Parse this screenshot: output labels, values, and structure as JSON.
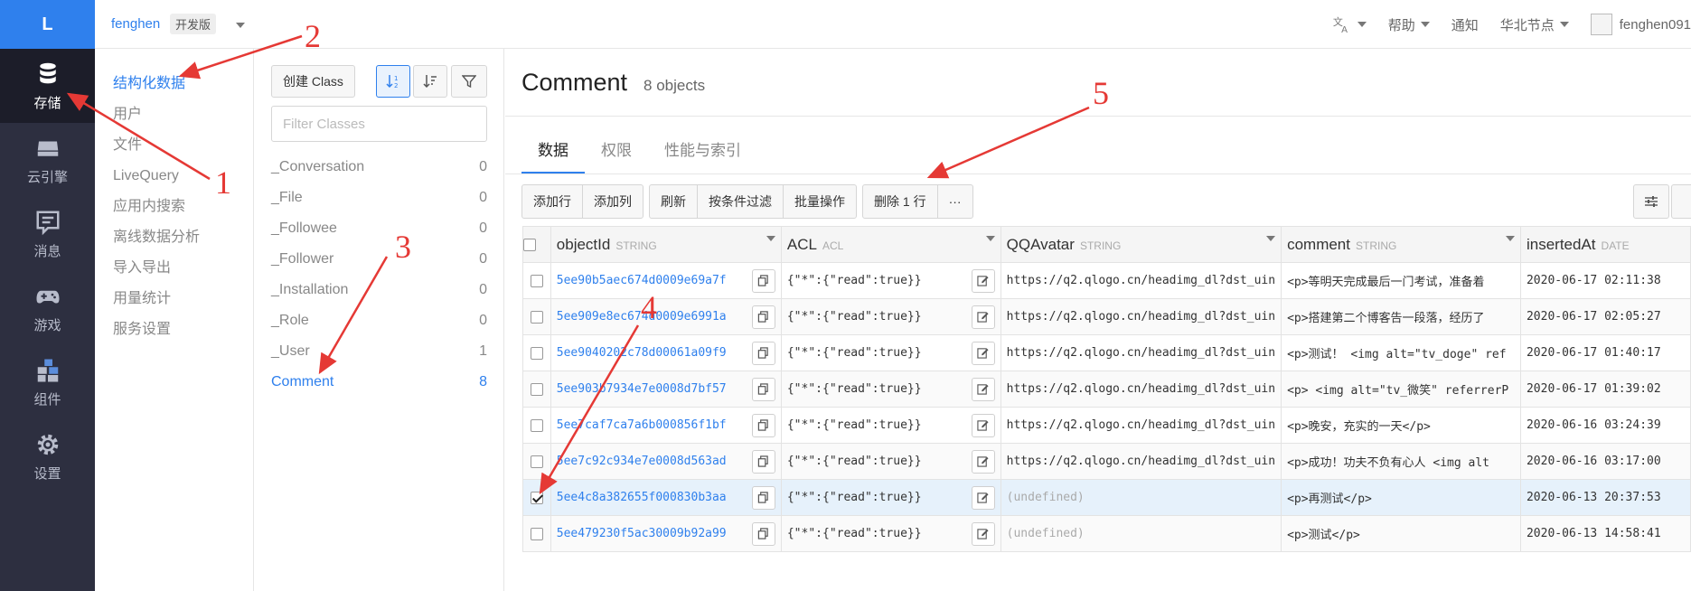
{
  "rail": {
    "logo": "L",
    "items": [
      {
        "label": "存储",
        "icon": "database-icon",
        "active": true
      },
      {
        "label": "云引擎",
        "icon": "server-icon",
        "active": false
      },
      {
        "label": "消息",
        "icon": "message-icon",
        "active": false
      },
      {
        "label": "游戏",
        "icon": "gamepad-icon",
        "active": false
      },
      {
        "label": "组件",
        "icon": "components-icon",
        "active": false
      },
      {
        "label": "设置",
        "icon": "gear-icon",
        "active": false
      }
    ]
  },
  "topbar": {
    "app_name": "fenghen",
    "plan_badge": "开发版",
    "translate_icon": "translate-icon",
    "help": "帮助",
    "notify": "通知",
    "region": "华北节点",
    "username": "fenghen091"
  },
  "subnav": {
    "items": [
      "结构化数据",
      "用户",
      "文件",
      "LiveQuery",
      "应用内搜索",
      "离线数据分析",
      "导入导出",
      "用量统计",
      "服务设置"
    ],
    "active_index": 0
  },
  "classes": {
    "create_label": "创建 Class",
    "filter_placeholder": "Filter Classes",
    "list": [
      {
        "name": "_Conversation",
        "count": "0"
      },
      {
        "name": "_File",
        "count": "0"
      },
      {
        "name": "_Followee",
        "count": "0"
      },
      {
        "name": "_Follower",
        "count": "0"
      },
      {
        "name": "_Installation",
        "count": "0"
      },
      {
        "name": "_Role",
        "count": "0"
      },
      {
        "name": "_User",
        "count": "1"
      },
      {
        "name": "Comment",
        "count": "8",
        "active": true
      }
    ]
  },
  "main": {
    "title": "Comment",
    "count": "8 objects",
    "tabs": [
      "数据",
      "权限",
      "性能与索引"
    ],
    "toolbar": {
      "add_row": "添加行",
      "add_col": "添加列",
      "refresh": "刷新",
      "filter": "按条件过滤",
      "batch": "批量操作",
      "delete": "删除 1 行",
      "more": "···"
    },
    "columns": [
      {
        "name": "objectId",
        "type": "STRING"
      },
      {
        "name": "ACL",
        "type": "ACL"
      },
      {
        "name": "QQAvatar",
        "type": "STRING"
      },
      {
        "name": "comment",
        "type": "STRING"
      },
      {
        "name": "insertedAt",
        "type": "DATE"
      }
    ],
    "rows": [
      {
        "id": "5ee90b5aec674d0009e69a7f",
        "acl": "{\"*\":{\"read\":true}}",
        "avatar": "https://q2.qlogo.cn/headimg_dl?dst_uin",
        "comment": "<p>等明天完成最后一门考试，准备着",
        "date": "2020-06-17 02:11:38",
        "checked": false
      },
      {
        "id": "5ee909e8ec674d0009e6991a",
        "acl": "{\"*\":{\"read\":true}}",
        "avatar": "https://q2.qlogo.cn/headimg_dl?dst_uin",
        "comment": "<p>搭建第二个博客告一段落，经历了",
        "date": "2020-06-17 02:05:27",
        "checked": false
      },
      {
        "id": "5ee9040202c78d00061a09f9",
        "acl": "{\"*\":{\"read\":true}}",
        "avatar": "https://q2.qlogo.cn/headimg_dl?dst_uin",
        "comment": "<p>测试！ <img alt=\"tv_doge\" ref",
        "date": "2020-06-17 01:40:17",
        "checked": false
      },
      {
        "id": "5ee903b7934e7e0008d7bf57",
        "acl": "{\"*\":{\"read\":true}}",
        "avatar": "https://q2.qlogo.cn/headimg_dl?dst_uin",
        "comment": "<p> <img alt=\"tv_微笑\" referrerP",
        "date": "2020-06-17 01:39:02",
        "checked": false
      },
      {
        "id": "5ee7caf7ca7a6b000856f1bf",
        "acl": "{\"*\":{\"read\":true}}",
        "avatar": "https://q2.qlogo.cn/headimg_dl?dst_uin",
        "comment": "<p>晚安，充实的一天</p>",
        "date": "2020-06-16 03:24:39",
        "checked": false
      },
      {
        "id": "5ee7c92c934e7e0008d563ad",
        "acl": "{\"*\":{\"read\":true}}",
        "avatar": "https://q2.qlogo.cn/headimg_dl?dst_uin",
        "comment": "<p>成功！功夫不负有心人 <img alt",
        "date": "2020-06-16 03:17:00",
        "checked": false
      },
      {
        "id": "5ee4c8a382655f000830b3aa",
        "acl": "{\"*\":{\"read\":true}}",
        "avatar": "(undefined)",
        "comment": "<p>再测试</p>",
        "date": "2020-06-13 20:37:53",
        "checked": true
      },
      {
        "id": "5ee479230f5ac30009b92a99",
        "acl": "{\"*\":{\"read\":true}}",
        "avatar": "(undefined)",
        "comment": "<p>测试</p>",
        "date": "2020-06-13 14:58:41",
        "checked": false
      }
    ]
  },
  "annotations": [
    "1",
    "2",
    "3",
    "4",
    "5"
  ],
  "colors": {
    "accent": "#2f80ed",
    "annotation": "#e53935",
    "rail": "#2d2f40"
  }
}
